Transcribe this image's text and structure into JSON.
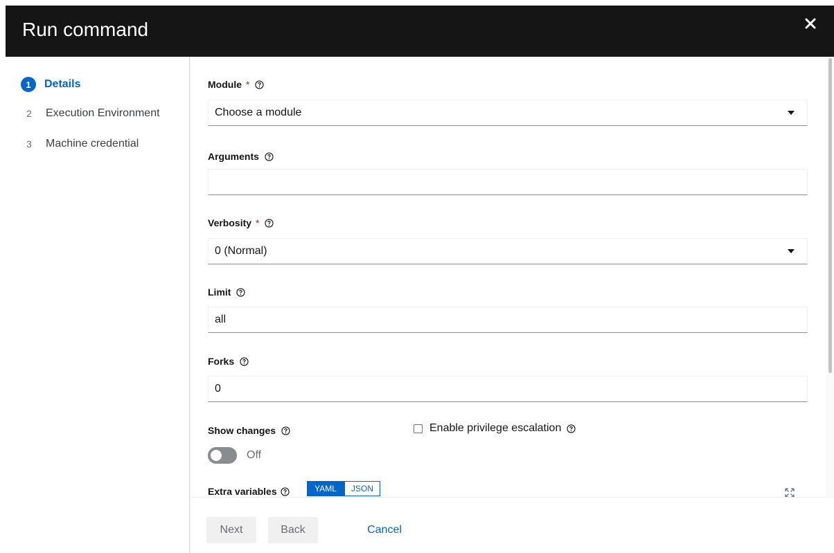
{
  "modal": {
    "title": "Run command",
    "close_label": "×"
  },
  "wizard_nav": [
    {
      "number": "1",
      "label": "Details",
      "current": true
    },
    {
      "number": "2",
      "label": "Execution Environment",
      "current": false
    },
    {
      "number": "3",
      "label": "Machine credential",
      "current": false
    }
  ],
  "form": {
    "module": {
      "label": "Module",
      "required_mark": "*",
      "value": "Choose a module"
    },
    "arguments": {
      "label": "Arguments",
      "value": ""
    },
    "verbosity": {
      "label": "Verbosity",
      "required_mark": "*",
      "value": "0 (Normal)"
    },
    "limit": {
      "label": "Limit",
      "value": "all"
    },
    "forks": {
      "label": "Forks",
      "value": "0"
    },
    "show_changes": {
      "label": "Show changes",
      "state_text": "Off",
      "enabled": false
    },
    "privilege_escalation": {
      "label": "Enable privilege escalation",
      "checked": false
    },
    "extra_variables": {
      "label": "Extra variables",
      "modes": [
        "YAML",
        "JSON"
      ],
      "active_mode": "YAML"
    }
  },
  "footer": {
    "next_label": "Next",
    "back_label": "Back",
    "cancel_label": "Cancel"
  },
  "colors": {
    "accent": "#0066cc",
    "header_bg": "#151515",
    "required": "#c9190b",
    "toggle_off": "#8a8d90"
  },
  "icons": {
    "help": "question-circle-icon",
    "close": "close-icon",
    "expand": "expand-icon",
    "dropdown": "caret-down-icon"
  }
}
